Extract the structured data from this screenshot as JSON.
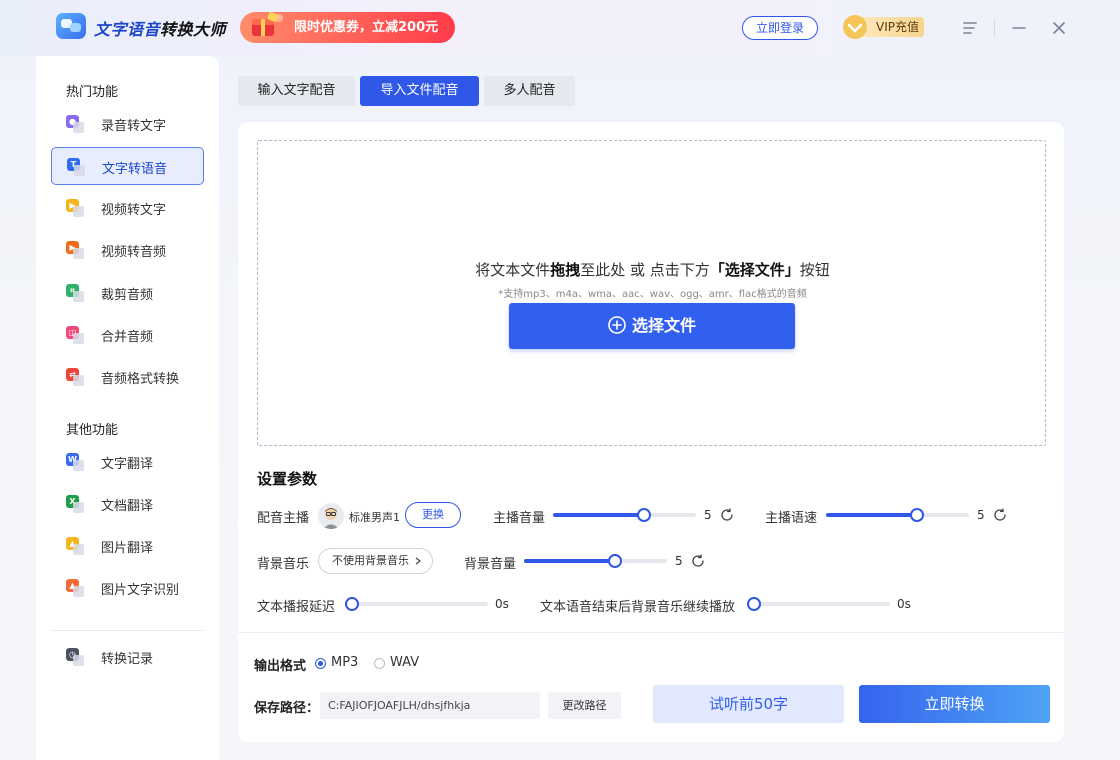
{
  "header": {
    "app_title_1": "文字语音",
    "app_title_2": "转换大师",
    "promo_text": "限时优惠券，立减200元",
    "login_label": "立即登录",
    "vip_label": "VIP充值"
  },
  "sidebar": {
    "section_hot": "热门功能",
    "section_other": "其他功能",
    "items": [
      {
        "label": "录音转文字",
        "icon": "microphone-icon",
        "color": "#8a6cf0"
      },
      {
        "label": "文字转语音",
        "icon": "text-icon",
        "color": "#2f6cf0",
        "active": true
      },
      {
        "label": "视频转文字",
        "icon": "video-icon",
        "color": "#f5b51c"
      },
      {
        "label": "视频转音频",
        "icon": "video-play-icon",
        "color": "#f56b1c"
      },
      {
        "label": "裁剪音频",
        "icon": "crop-icon",
        "color": "#2fb36a"
      },
      {
        "label": "合并音频",
        "icon": "merge-icon",
        "color": "#f04a7a"
      },
      {
        "label": "音频格式转换",
        "icon": "swap-icon",
        "color": "#f0463a"
      },
      {
        "label": "文字翻译",
        "icon": "word-icon",
        "color": "#3a6cf0"
      },
      {
        "label": "文档翻译",
        "icon": "excel-icon",
        "color": "#1f9e4a"
      },
      {
        "label": "图片翻译",
        "icon": "image-icon",
        "color": "#f5b51c"
      },
      {
        "label": "图片文字识别",
        "icon": "image-text-icon",
        "color": "#f56b3a"
      },
      {
        "label": "转换记录",
        "icon": "history-icon",
        "color": "#4a5263"
      }
    ]
  },
  "tabs": [
    {
      "label": "输入文字配音"
    },
    {
      "label": "导入文件配音",
      "active": true
    },
    {
      "label": "多人配音"
    }
  ],
  "dropzone": {
    "text_1": "将文本文件",
    "text_bold_1": "拖拽",
    "text_2": "至此处 或 点击下方",
    "text_bold_2": "「选择文件」",
    "text_3": "按钮",
    "subtext": "*支持mp3、m4a、wma、aac、wav、ogg、amr、flac格式的音频",
    "button_label": "选择文件"
  },
  "settings": {
    "title": "设置参数",
    "anchor_label": "配音主播",
    "anchor_name": "标准男声1",
    "change_label": "更换",
    "anchor_volume_label": "主播音量",
    "anchor_volume": {
      "value": "5",
      "fraction": 0.65
    },
    "anchor_speed_label": "主播语速",
    "anchor_speed": {
      "value": "5",
      "fraction": 0.65
    },
    "bgm_label": "背景音乐",
    "bgm_value": "不使用背景音乐",
    "bgm_volume_label": "背景音量",
    "bgm_volume": {
      "value": "5",
      "fraction": 0.65
    },
    "delay_label": "文本播报延迟",
    "delay": {
      "value": "0s",
      "fraction": 0
    },
    "continue_label": "文本语音结束后背景音乐继续播放",
    "continue": {
      "value": "0s",
      "fraction": 0
    }
  },
  "output": {
    "format_label": "输出格式",
    "formats": [
      {
        "label": "MP3",
        "selected": true
      },
      {
        "label": "WAV",
        "selected": false
      }
    ],
    "save_label": "保存路径：",
    "save_path": "C:FAJIOFJOAFJLH/dhsjfhkja",
    "change_path_label": "更改路径",
    "preview_label": "试听前50字",
    "convert_label": "立即转换"
  },
  "colors": {
    "accent": "#2f57e8",
    "promo": "#ff3b4a",
    "vip": "#f8d58d"
  }
}
